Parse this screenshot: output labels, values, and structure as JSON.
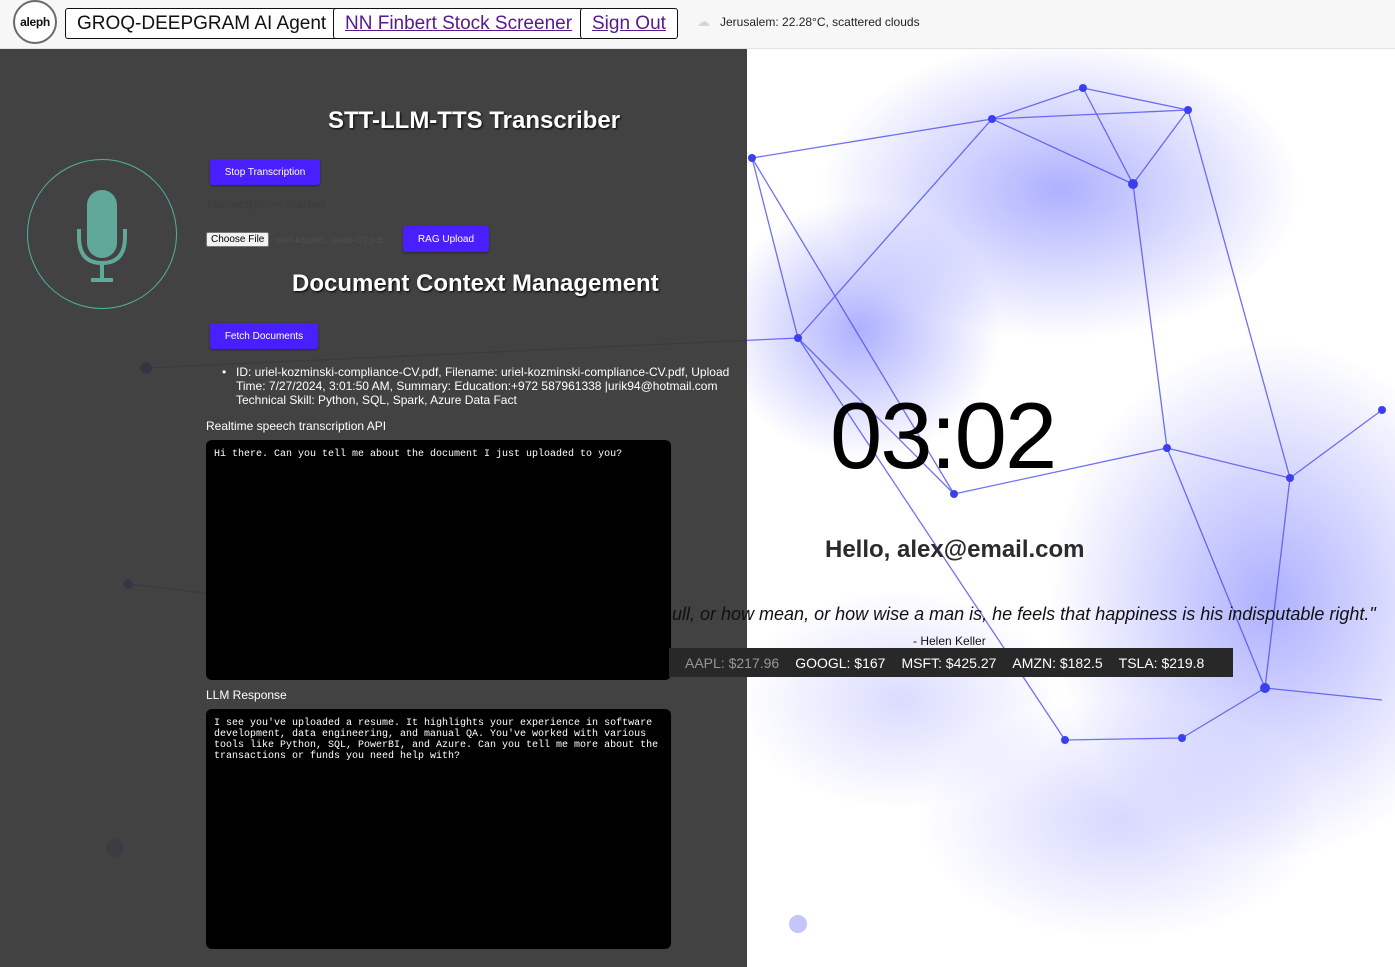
{
  "header": {
    "logo_text": "aleph",
    "app_button": "GROQ-DEEPGRAM AI Agent",
    "screener_link": "NN Finbert Stock Screener",
    "signout_link": "Sign Out",
    "weather_icon": "cloud-icon",
    "weather_text": "Jerusalem: 22.28°C, scattered clouds"
  },
  "transcriber": {
    "title": "STT-LLM-TTS Transcriber",
    "stop_button": "Stop Transcription",
    "status": "Transcription started",
    "choose_file": "Choose File",
    "file_name": "uriel-kozmin...iance-CV.pdf",
    "rag_button": "RAG Upload"
  },
  "documents": {
    "title": "Document Context Management",
    "fetch_button": "Fetch Documents",
    "items": [
      "ID: uriel-kozminski-compliance-CV.pdf, Filename: uriel-kozminski-compliance-CV.pdf, Upload Time: 7/27/2024, 3:01:50 AM, Summary: Education:+972 587961338 |urik94@hotmail.com Technical Skill: Python, SQL, Spark, Azure Data Fact"
    ]
  },
  "speech": {
    "label": "Realtime speech transcription API",
    "text": "Hi there. Can you tell me about the document I just uploaded to you?"
  },
  "llm": {
    "label": "LLM Response",
    "text": "I see you've uploaded a resume. It highlights your experience in software development, data engineering, and manual QA. You've worked with various tools like Python, SQL, PowerBI, and Azure. Can you tell me more about the transactions or funds you need help with?"
  },
  "dashboard": {
    "clock": "03:02",
    "greeting": "Hello, alex@email.com",
    "quote": "ull, or how mean, or how wise a man is, he feels that happiness is his indisputable right.\"",
    "author": "- Helen Keller",
    "tickers": [
      "AAPL: $217.96",
      "GOOGL: $167",
      "MSFT: $425.27",
      "AMZN: $182.5",
      "TSLA: $219.8"
    ]
  },
  "colors": {
    "primary_button": "#4a1fff",
    "mic_accent": "#5fa89a",
    "network": "#4b4ff0"
  }
}
